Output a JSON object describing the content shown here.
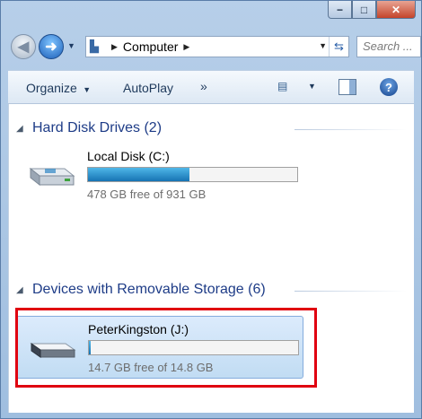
{
  "window": {
    "caption_buttons": {
      "minimize": "−",
      "maximize": "□",
      "close": "✕"
    }
  },
  "address_bar": {
    "path": "Computer",
    "search_placeholder": "Search ..."
  },
  "toolbar": {
    "organize": "Organize",
    "autoplay": "AutoPlay",
    "more": "»"
  },
  "groups": [
    {
      "title": "Hard Disk Drives (2)",
      "drives": [
        {
          "name": "Local Disk (C:)",
          "free_text": "478 GB free of 931 GB",
          "used_fraction": 0.486
        }
      ]
    },
    {
      "title": "Devices with Removable Storage (6)",
      "drives": [
        {
          "name": "PeterKingston (J:)",
          "free_text": "14.7 GB free of 14.8 GB",
          "used_fraction": 0.007
        }
      ]
    }
  ],
  "colors": {
    "group_header": "#1e3c87",
    "bar_fill": "#1673b3",
    "highlight": "#e00010"
  },
  "icons": [
    "back-arrow-icon",
    "forward-arrow-icon",
    "computer-icon",
    "refresh-icon",
    "views-icon",
    "preview-pane-icon",
    "help-icon",
    "drive-icon",
    "usb-drive-icon"
  ]
}
